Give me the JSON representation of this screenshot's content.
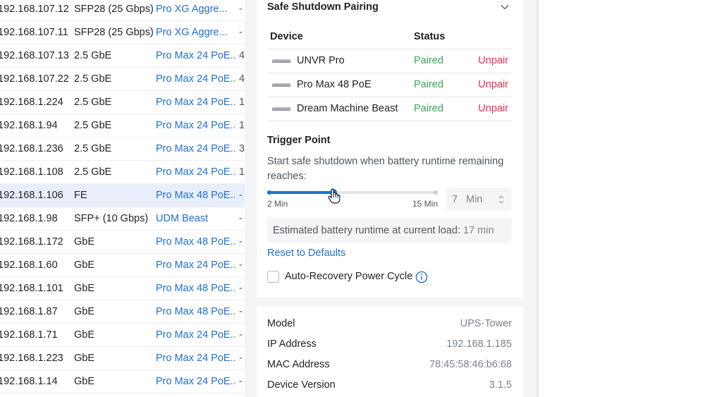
{
  "table": {
    "rows": [
      {
        "ip": "192.168.107.12",
        "speed": "SFP28 (25 Gbps)",
        "device": "Pro XG Aggre...",
        "extra": "-"
      },
      {
        "ip": "192.168.107.11",
        "speed": "SFP28 (25 Gbps)",
        "device": "Pro XG Aggre...",
        "extra": "-"
      },
      {
        "ip": "192.168.107.13",
        "speed": "2.5 GbE",
        "device": "Pro Max 24 PoE...",
        "extra": "4"
      },
      {
        "ip": "192.168.107.22",
        "speed": "2.5 GbE",
        "device": "Pro Max 24 PoE...",
        "extra": "4"
      },
      {
        "ip": "192.168.1.224",
        "speed": "2.5 GbE",
        "device": "Pro Max 24 PoE...",
        "extra": "1"
      },
      {
        "ip": "192.168.1.94",
        "speed": "2.5 GbE",
        "device": "Pro Max 24 PoE...",
        "extra": "1"
      },
      {
        "ip": "192.168.1.236",
        "speed": "2.5 GbE",
        "device": "Pro Max 24 PoE...",
        "extra": "3"
      },
      {
        "ip": "192.168.1.108",
        "speed": "2.5 GbE",
        "device": "Pro Max 24 PoE...",
        "extra": "1"
      },
      {
        "ip": "192.168.1.106",
        "speed": "FE",
        "device": "Pro Max 48 PoE...",
        "extra": "-",
        "selected": true
      },
      {
        "ip": "192.168.1.98",
        "speed": "SFP+ (10 Gbps)",
        "device": "UDM Beast",
        "extra": "-"
      },
      {
        "ip": "192.168.1.172",
        "speed": "GbE",
        "device": "Pro Max 48 PoE...",
        "extra": "-"
      },
      {
        "ip": "192.168.1.60",
        "speed": "GbE",
        "device": "Pro Max 24 PoE...",
        "extra": "-"
      },
      {
        "ip": "192.168.1.101",
        "speed": "GbE",
        "device": "Pro Max 48 PoE...",
        "extra": "-"
      },
      {
        "ip": "192.168.1.87",
        "speed": "GbE",
        "device": "Pro Max 48 PoE...",
        "extra": "-"
      },
      {
        "ip": "192.168.1.71",
        "speed": "GbE",
        "device": "Pro Max 24 PoE...",
        "extra": "-"
      },
      {
        "ip": "192.168.1.223",
        "speed": "GbE",
        "device": "Pro Max 24 PoE...",
        "extra": "-"
      },
      {
        "ip": "192.168.1.14",
        "speed": "GbE",
        "device": "Pro Max 24 PoE...",
        "extra": "-"
      }
    ]
  },
  "pairing": {
    "title": "Safe Shutdown Pairing",
    "col_device": "Device",
    "col_status": "Status",
    "devices": [
      {
        "name": "UNVR Pro",
        "status": "Paired",
        "action": "Unpair"
      },
      {
        "name": "Pro Max 48 PoE",
        "status": "Paired",
        "action": "Unpair"
      },
      {
        "name": "Dream Machine Beast",
        "status": "Paired",
        "action": "Unpair"
      }
    ]
  },
  "trigger": {
    "title": "Trigger Point",
    "description": "Start safe shutdown when battery runtime remaining reaches:",
    "slider_min_label": "2 Min",
    "slider_max_label": "15 Min",
    "slider_min": 2,
    "slider_max": 15,
    "slider_value": 7,
    "value": "7",
    "unit": "Min",
    "estimate_label": "Estimated battery runtime at current load:",
    "estimate_value": "17 min",
    "reset_label": "Reset to Defaults",
    "auto_recovery_label": "Auto-Recovery Power Cycle",
    "auto_recovery_checked": false
  },
  "details": {
    "items": [
      {
        "key": "Model",
        "value": "UPS-Tower"
      },
      {
        "key": "IP Address",
        "value": "192.168.1.185"
      },
      {
        "key": "MAC Address",
        "value": "78:45:58:46:b6:68"
      },
      {
        "key": "Device Version",
        "value": "3.1.5"
      }
    ]
  },
  "icons": {
    "chevron": "chevron-down-icon",
    "info": "info-icon",
    "stepper": "stepper-icon",
    "cursor": "hand-pointer-icon"
  },
  "colors": {
    "accent": "#1f6fd1",
    "paired": "#38a85a",
    "unpair": "#d6354a"
  }
}
